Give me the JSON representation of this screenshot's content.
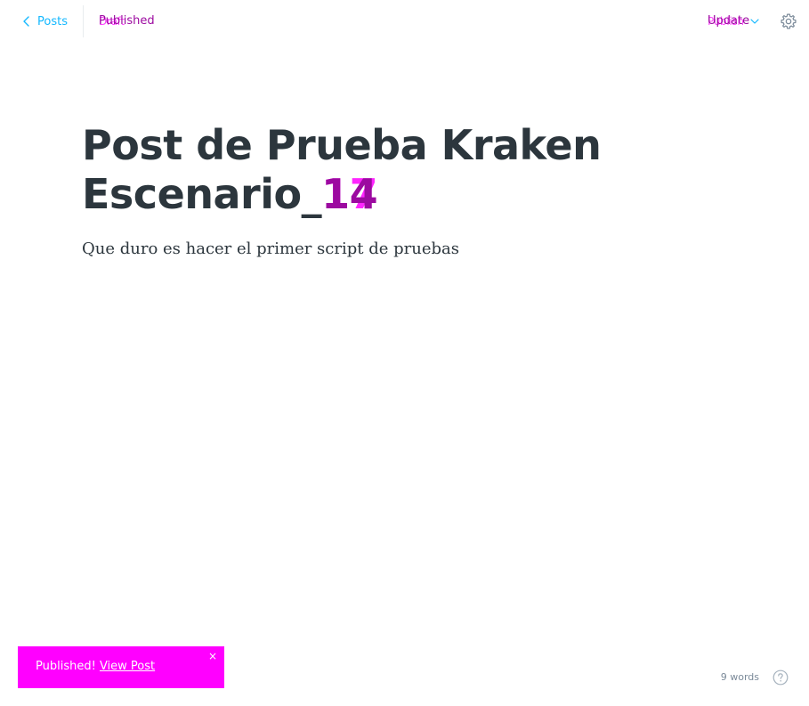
{
  "header": {
    "back_label": "Posts",
    "status_label": "Published",
    "status_label_prev": "Draft",
    "update_label": "Update",
    "update_label_prev": "Publish"
  },
  "post": {
    "title_prefix": "Post de Prueba Kraken Escenario_",
    "title_number": "14",
    "title_number_prev": "17",
    "body": "Que duro es hacer el primer script de pruebas"
  },
  "toast": {
    "message": "Published!",
    "link_label": "View Post",
    "close_glyph": "×"
  },
  "footer": {
    "word_count": "9 words"
  },
  "colors": {
    "accent": "#14b8ff",
    "highlight": "#ff00ff",
    "status_text": "#9c0aa0",
    "title_text": "#2c363d"
  },
  "icons": [
    "chevron-left-icon",
    "chevron-down-icon",
    "gear-icon",
    "question-circle-icon",
    "close-icon"
  ]
}
